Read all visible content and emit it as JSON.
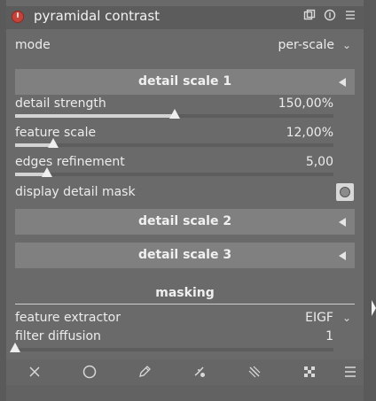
{
  "module": {
    "title": "pyramidal contrast",
    "header_icons": [
      "power-icon",
      "multi-instance-icon",
      "reset-icon",
      "presets-menu-icon"
    ]
  },
  "mode": {
    "label": "mode",
    "value": "per-scale"
  },
  "sections": {
    "detail_scale_1": {
      "title": "detail scale 1",
      "detail_strength": {
        "label": "detail strength",
        "value": "150,00%",
        "fill_fraction": 0.5
      },
      "feature_scale": {
        "label": "feature scale",
        "value": "12,00%",
        "fill_fraction": 0.12
      },
      "edges_refinement": {
        "label": "edges refinement",
        "value": "5,00",
        "fill_fraction": 0.1
      },
      "display_detail_mask": {
        "label": "display detail mask",
        "icon": "toggle-icon"
      }
    },
    "detail_scale_2": {
      "title": "detail scale 2"
    },
    "detail_scale_3": {
      "title": "detail scale 3"
    },
    "masking": {
      "title": "masking",
      "feature_extractor": {
        "label": "feature extractor",
        "value": "EIGF"
      },
      "filter_diffusion": {
        "label": "filter diffusion",
        "value": "1",
        "fill_fraction": 0.0
      }
    }
  },
  "toolbar": {
    "icons": [
      "close-icon",
      "circle-icon",
      "pencil-icon",
      "brush-icon",
      "gradient-icon",
      "checker-icon",
      "menu-icon"
    ]
  },
  "colors": {
    "power": "#c5433a",
    "section_bar": "#808080",
    "background": "#6a6a6a"
  }
}
